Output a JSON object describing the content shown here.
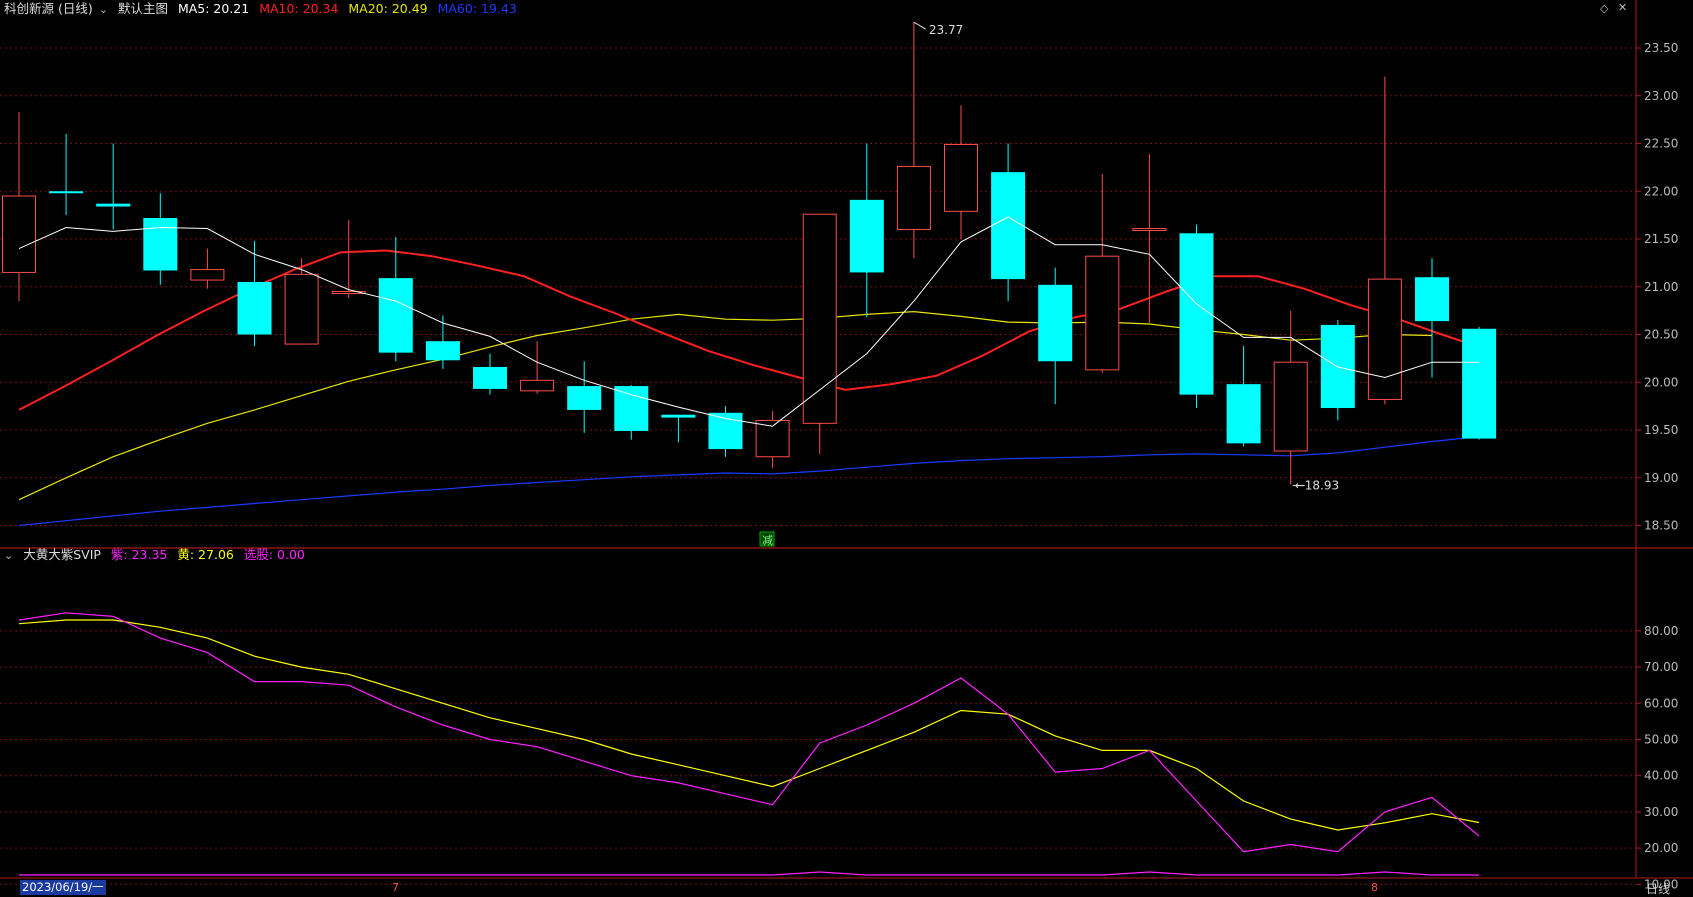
{
  "colors": {
    "bg": "#000000",
    "grid": "#7a1010",
    "border": "#b01818",
    "up": "#ff4b4b",
    "down": "#00ffff",
    "ma5": "#ffffff",
    "ma10": "#ff2020",
    "ma20": "#e6e600",
    "ma60": "#1a3aff",
    "zi": "#ff20ff",
    "huang": "#ffff00",
    "axis_text": "#bbbbbb"
  },
  "header": {
    "title": "科创新源 (日线)",
    "main_label": "默认主图",
    "ma5": "MA5: 20.21",
    "ma10": "MA10: 20.34",
    "ma20": "MA20: 20.49",
    "ma60": "MA60: 19.43"
  },
  "indicator_header": {
    "name": "大黄大紫SVIP",
    "zi": "紫: 23.35",
    "huang": "黄: 27.06",
    "xuangu": "选股: 0.00"
  },
  "marks": {
    "high_label": "23.77",
    "low_label": "18.93",
    "jian_label": "减"
  },
  "x_axis": {
    "start_date": "2023/06/19/一",
    "month7": "7",
    "month8": "8",
    "period_label": "日线"
  },
  "price_axis": {
    "ylim": [
      18.25,
      23.8
    ],
    "ticks": [
      "18.50",
      "19.00",
      "19.50",
      "20.00",
      "20.50",
      "21.00",
      "21.50",
      "22.00",
      "22.50",
      "23.00",
      "23.50"
    ]
  },
  "indicator_axis": {
    "ylim": [
      -2,
      88
    ],
    "ticks": [
      "10.00",
      "20.00",
      "30.00",
      "40.00",
      "50.00",
      "60.00",
      "70.00",
      "80.00"
    ]
  },
  "chart_data": [
    {
      "type": "candlestick",
      "title": "科创新源 (日线)",
      "candles": [
        {
          "o": 21.15,
          "h": 22.83,
          "l": 20.85,
          "c": 21.95
        },
        {
          "o": 22.0,
          "h": 22.6,
          "l": 21.75,
          "c": 21.98
        },
        {
          "o": 21.87,
          "h": 22.5,
          "l": 21.6,
          "c": 21.84
        },
        {
          "o": 21.72,
          "h": 21.98,
          "l": 21.02,
          "c": 21.17
        },
        {
          "o": 21.07,
          "h": 21.4,
          "l": 20.98,
          "c": 21.18
        },
        {
          "o": 21.05,
          "h": 21.48,
          "l": 20.38,
          "c": 20.5
        },
        {
          "o": 20.4,
          "h": 21.3,
          "l": 20.4,
          "c": 21.13
        },
        {
          "o": 20.95,
          "h": 21.7,
          "l": 20.88,
          "c": 20.95
        },
        {
          "o": 21.09,
          "h": 21.52,
          "l": 20.22,
          "c": 20.31
        },
        {
          "o": 20.43,
          "h": 20.7,
          "l": 20.14,
          "c": 20.23
        },
        {
          "o": 20.16,
          "h": 20.3,
          "l": 19.87,
          "c": 19.93
        },
        {
          "o": 19.91,
          "h": 20.43,
          "l": 19.88,
          "c": 20.02
        },
        {
          "o": 19.96,
          "h": 20.22,
          "l": 19.47,
          "c": 19.71
        },
        {
          "o": 19.96,
          "h": 19.97,
          "l": 19.4,
          "c": 19.49
        },
        {
          "o": 19.66,
          "h": 19.66,
          "l": 19.37,
          "c": 19.63
        },
        {
          "o": 19.68,
          "h": 19.75,
          "l": 19.22,
          "c": 19.3
        },
        {
          "o": 19.22,
          "h": 19.7,
          "l": 19.1,
          "c": 19.6
        },
        {
          "o": 19.57,
          "h": 20.1,
          "l": 19.25,
          "c": 21.76
        },
        {
          "o": 21.91,
          "h": 22.5,
          "l": 20.68,
          "c": 21.15
        },
        {
          "o": 21.6,
          "h": 23.77,
          "l": 21.3,
          "c": 22.26
        },
        {
          "o": 21.79,
          "h": 22.9,
          "l": 21.5,
          "c": 22.49
        },
        {
          "o": 22.2,
          "h": 22.5,
          "l": 20.85,
          "c": 21.08
        },
        {
          "o": 21.02,
          "h": 21.2,
          "l": 19.77,
          "c": 20.22
        },
        {
          "o": 20.13,
          "h": 22.18,
          "l": 20.1,
          "c": 21.32
        },
        {
          "o": 21.61,
          "h": 22.39,
          "l": 20.62,
          "c": 21.61
        },
        {
          "o": 21.56,
          "h": 21.65,
          "l": 19.73,
          "c": 19.87
        },
        {
          "o": 19.98,
          "h": 20.38,
          "l": 19.33,
          "c": 19.36
        },
        {
          "o": 19.28,
          "h": 20.75,
          "l": 18.93,
          "c": 20.21
        },
        {
          "o": 20.6,
          "h": 20.65,
          "l": 19.6,
          "c": 19.73
        },
        {
          "o": 19.82,
          "h": 23.2,
          "l": 19.77,
          "c": 21.08
        },
        {
          "o": 21.1,
          "h": 21.3,
          "l": 20.05,
          "c": 20.64
        },
        {
          "o": 20.56,
          "h": 20.58,
          "l": 19.4,
          "c": 19.41
        }
      ],
      "ma5": [
        21.4,
        21.62,
        21.58,
        21.62,
        21.61,
        21.34,
        21.18,
        20.97,
        20.85,
        20.62,
        20.48,
        20.21,
        20.02,
        19.87,
        19.74,
        19.62,
        19.54,
        19.92,
        20.3,
        20.85,
        21.47,
        21.73,
        21.44,
        21.44,
        21.34,
        20.82,
        20.47,
        20.47,
        20.16,
        20.05,
        20.21,
        20.21
      ],
      "ma10": [
        19.71,
        19.96,
        20.22,
        20.49,
        20.74,
        20.97,
        21.18,
        21.36,
        21.38,
        21.32,
        21.22,
        21.11,
        20.9,
        20.72,
        20.52,
        20.33,
        20.18,
        20.05,
        19.92,
        19.98,
        20.07,
        20.28,
        20.53,
        20.68,
        20.77,
        20.95,
        21.11,
        21.11,
        20.98,
        20.81,
        20.67,
        20.5,
        20.34
      ],
      "ma20": [
        18.77,
        19.0,
        19.22,
        19.4,
        19.57,
        19.71,
        19.86,
        20.01,
        20.13,
        20.24,
        20.37,
        20.49,
        20.57,
        20.66,
        20.71,
        20.66,
        20.65,
        20.67,
        20.71,
        20.74,
        20.69,
        20.63,
        20.62,
        20.63,
        20.61,
        20.55,
        20.5,
        20.44,
        20.46,
        20.5,
        20.49
      ],
      "ma60": [
        18.5,
        18.55,
        18.6,
        18.65,
        18.69,
        18.73,
        18.77,
        18.81,
        18.85,
        18.88,
        18.92,
        18.95,
        18.98,
        19.01,
        19.03,
        19.05,
        19.04,
        19.07,
        19.11,
        19.15,
        19.18,
        19.2,
        19.21,
        19.22,
        19.24,
        19.25,
        19.24,
        19.23,
        19.26,
        19.32,
        19.38,
        19.43
      ]
    },
    {
      "type": "line",
      "title": "大黄大紫SVIP",
      "series": [
        {
          "name": "紫",
          "values": [
            83,
            85,
            84,
            78,
            74,
            66,
            66,
            65,
            59,
            54,
            50,
            48,
            44,
            40,
            38,
            35,
            32,
            49,
            54,
            60,
            67,
            57,
            41,
            42,
            47,
            33,
            19,
            21,
            19,
            30,
            34,
            23.35
          ]
        },
        {
          "name": "黄",
          "values": [
            82,
            83,
            83,
            81,
            78,
            73,
            70,
            68,
            64,
            60,
            56,
            53,
            50,
            46,
            43,
            40,
            37,
            42,
            47,
            52,
            58,
            57,
            51,
            47,
            47,
            42,
            33,
            28,
            25,
            27,
            29.5,
            27.06
          ]
        },
        {
          "name": "选股",
          "values": [
            0,
            0,
            0,
            0,
            0,
            0,
            0,
            0,
            0,
            0,
            0,
            0,
            0,
            0,
            0,
            0,
            0,
            1,
            0,
            0,
            0,
            0,
            0,
            0,
            1,
            0,
            0,
            0,
            0,
            1,
            0,
            0
          ]
        }
      ]
    }
  ]
}
